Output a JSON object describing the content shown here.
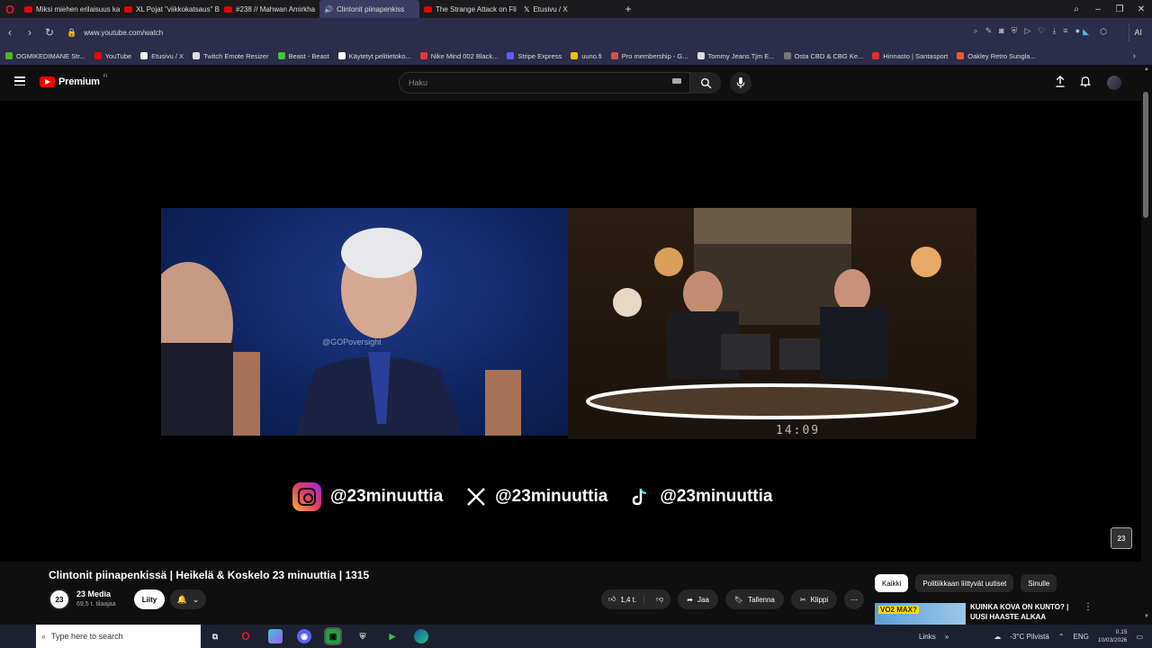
{
  "browser": {
    "tabs": [
      {
        "label": "Miksi miehen erilaisuus ka",
        "icon": "youtube-icon"
      },
      {
        "label": "XL Pojat \"viikkokatsaus\" B",
        "icon": "youtube-icon"
      },
      {
        "label": "#238 // Mahwan Amirkha",
        "icon": "youtube-icon"
      },
      {
        "label": "Clintonit piinapenkiss",
        "icon": "youtube-icon",
        "active": true
      },
      {
        "label": "The Strange Attack on Fli",
        "icon": "youtube-icon"
      },
      {
        "label": "Etusivu / X",
        "icon": "x-icon"
      }
    ],
    "url": "www.youtube.com/watch",
    "ai_label": "AI",
    "bookmarks": [
      {
        "label": "OGMIKEDIMANE Str...",
        "color": "#53b51c"
      },
      {
        "label": "YouTube",
        "color": "#ff0000"
      },
      {
        "label": "Etusivu / X",
        "color": "#ffffff"
      },
      {
        "label": "Twitch Emote Resizer",
        "color": "#dddddd"
      },
      {
        "label": "Beast - Beast",
        "color": "#46c141"
      },
      {
        "label": "Käytetyt pelitietoko...",
        "color": "#ffffff"
      },
      {
        "label": "Nike Mind 002 Black...",
        "color": "#e03a3a"
      },
      {
        "label": "Stripe Express",
        "color": "#635bff"
      },
      {
        "label": "uuno.fi",
        "color": "#f0c000"
      },
      {
        "label": "Pro membership - G...",
        "color": "#e04a4a"
      },
      {
        "label": "Tommy Jeans Tjm E...",
        "color": "#dddddd"
      },
      {
        "label": "Osta CBD & CBG Ke...",
        "color": "#777777"
      },
      {
        "label": "Hinnasto | Santasport",
        "color": "#e03030"
      },
      {
        "label": "Oakley Retro Sungla...",
        "color": "#e85b2a"
      }
    ]
  },
  "youtube": {
    "logo_text": "Premium",
    "logo_country": "FI",
    "search_placeholder": "Haku"
  },
  "video": {
    "watermark": "@GOPoversight",
    "clock": "14:09",
    "socials": [
      {
        "platform": "instagram-icon",
        "handle": "@23minuuttia"
      },
      {
        "platform": "x-icon",
        "handle": "@23minuuttia"
      },
      {
        "platform": "tiktok-icon",
        "handle": "@23minuuttia"
      }
    ],
    "channel_badge": "23"
  },
  "meta": {
    "title": "Clintonit piinapenkissä | Heikelä & Koskelo 23 minuuttia | 1315",
    "channel_name": "23 Media",
    "channel_badge": "23",
    "subscribers": "69,5 t. tilaajaa",
    "join_label": "Liity",
    "likes": "1,4 t.",
    "share_label": "Jaa",
    "save_label": "Tallenna",
    "clip_label": "Klippi"
  },
  "sidebar": {
    "chips": [
      "Kaikki",
      "Politiikkaan liittyvät uutiset",
      "Sinulle"
    ],
    "recommendation": {
      "thumb_text": "VO2 MAX?",
      "title": "KUINKA KOVA ON KUNTO? | UUSI HAASTE ALKAA"
    }
  },
  "taskbar": {
    "search_placeholder": "Type here to search",
    "links_label": "Links",
    "weather": "-3°C Pilvistä",
    "language": "ENG",
    "time": "0.15",
    "date": "10/03/2026"
  }
}
